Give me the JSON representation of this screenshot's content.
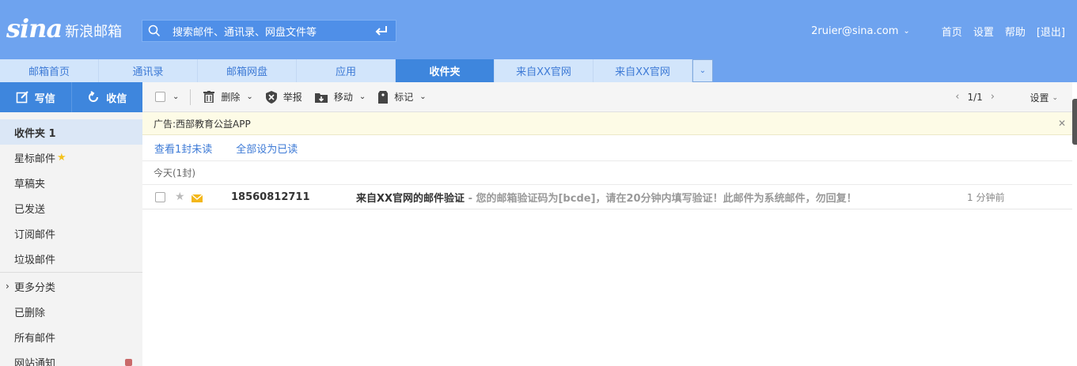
{
  "header": {
    "logo_mark": "sina",
    "logo_text": "新浪邮箱",
    "search_placeholder": "搜索邮件、通讯录、网盘文件等",
    "account": "2ruier@sina.com",
    "links": [
      "首页",
      "设置",
      "帮助",
      "[退出]"
    ]
  },
  "tabs": [
    {
      "label": "邮箱首页",
      "active": false
    },
    {
      "label": "通讯录",
      "active": false
    },
    {
      "label": "邮箱网盘",
      "active": false
    },
    {
      "label": "应用",
      "active": false
    },
    {
      "label": "收件夹",
      "active": true
    },
    {
      "label": "来自XX官网",
      "active": false
    },
    {
      "label": "来自XX官网",
      "active": false
    }
  ],
  "sidebar": {
    "write_label": "写信",
    "receive_label": "收信",
    "folders": [
      {
        "label": "收件夹 1",
        "active": true
      },
      {
        "label": "星标邮件"
      },
      {
        "label": "草稿夹"
      },
      {
        "label": "已发送"
      },
      {
        "label": "订阅邮件"
      },
      {
        "label": "垃圾邮件"
      },
      {
        "label": "更多分类"
      },
      {
        "label": "已删除"
      },
      {
        "label": "所有邮件"
      },
      {
        "label": "网站通知"
      }
    ]
  },
  "toolbar": {
    "delete_label": "删除",
    "report_label": "举报",
    "move_label": "移动",
    "mark_label": "标记",
    "pager": "1/1",
    "settings_label": "设置"
  },
  "ad": {
    "text": "广告:西部教育公益APP"
  },
  "actions": {
    "view_unread": "查看1封未读",
    "mark_all_read": "全部设为已读"
  },
  "mail_group": {
    "label": "今天(1封)"
  },
  "mails": [
    {
      "sender": "18560812711",
      "subject": "来自XX官网的邮件验证",
      "preview": " - 您的邮箱验证码为[bcde]，请在20分钟内填写验证！此邮件为系统邮件，勿回复！",
      "time": "1 分钟前"
    }
  ],
  "colors": {
    "header_bg": "#6ea3ef",
    "accent": "#3e86dd",
    "tab_bg": "#d2e5fb",
    "ad_bg": "#fdfbe6"
  }
}
